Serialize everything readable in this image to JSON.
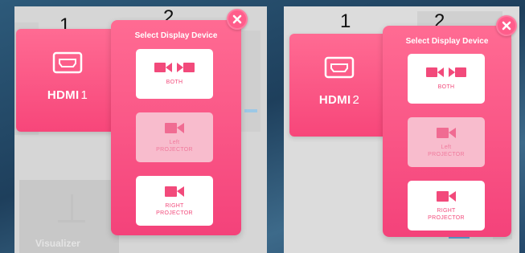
{
  "colors": {
    "accent": "#f7467a",
    "accent_light": "#ff6b93",
    "dim_button": "#f8bccd",
    "close": "#ff5d8b"
  },
  "left_panel": {
    "step_labels": [
      "1",
      "2"
    ],
    "hdmi_tile": {
      "label": "HDMI",
      "number": "1",
      "icon": "hdmi-port-icon"
    },
    "popup": {
      "title": "Select Display Device",
      "close_icon": "close-icon",
      "buttons": [
        {
          "label": "BOTH",
          "icon": "dual-camera-icon",
          "state": "active"
        },
        {
          "label": "Left\nPROJECTOR",
          "icon": "camera-icon",
          "state": "dim"
        },
        {
          "label": "RIGHT\nPROJECTOR",
          "icon": "camera-icon",
          "state": "active"
        }
      ]
    },
    "background_tile_label": "Visualizer"
  },
  "right_panel": {
    "step_labels": [
      "1",
      "2"
    ],
    "hdmi_tile": {
      "label": "HDMI",
      "number": "2",
      "icon": "hdmi-port-icon"
    },
    "popup": {
      "title": "Select Display Device",
      "close_icon": "close-icon",
      "buttons": [
        {
          "label": "BOTH",
          "icon": "dual-camera-icon",
          "state": "active"
        },
        {
          "label": "Left\nPROJECTOR",
          "icon": "camera-icon",
          "state": "dim"
        },
        {
          "label": "RIGHT\nPROJECTOR",
          "icon": "camera-icon",
          "state": "active"
        }
      ]
    }
  }
}
